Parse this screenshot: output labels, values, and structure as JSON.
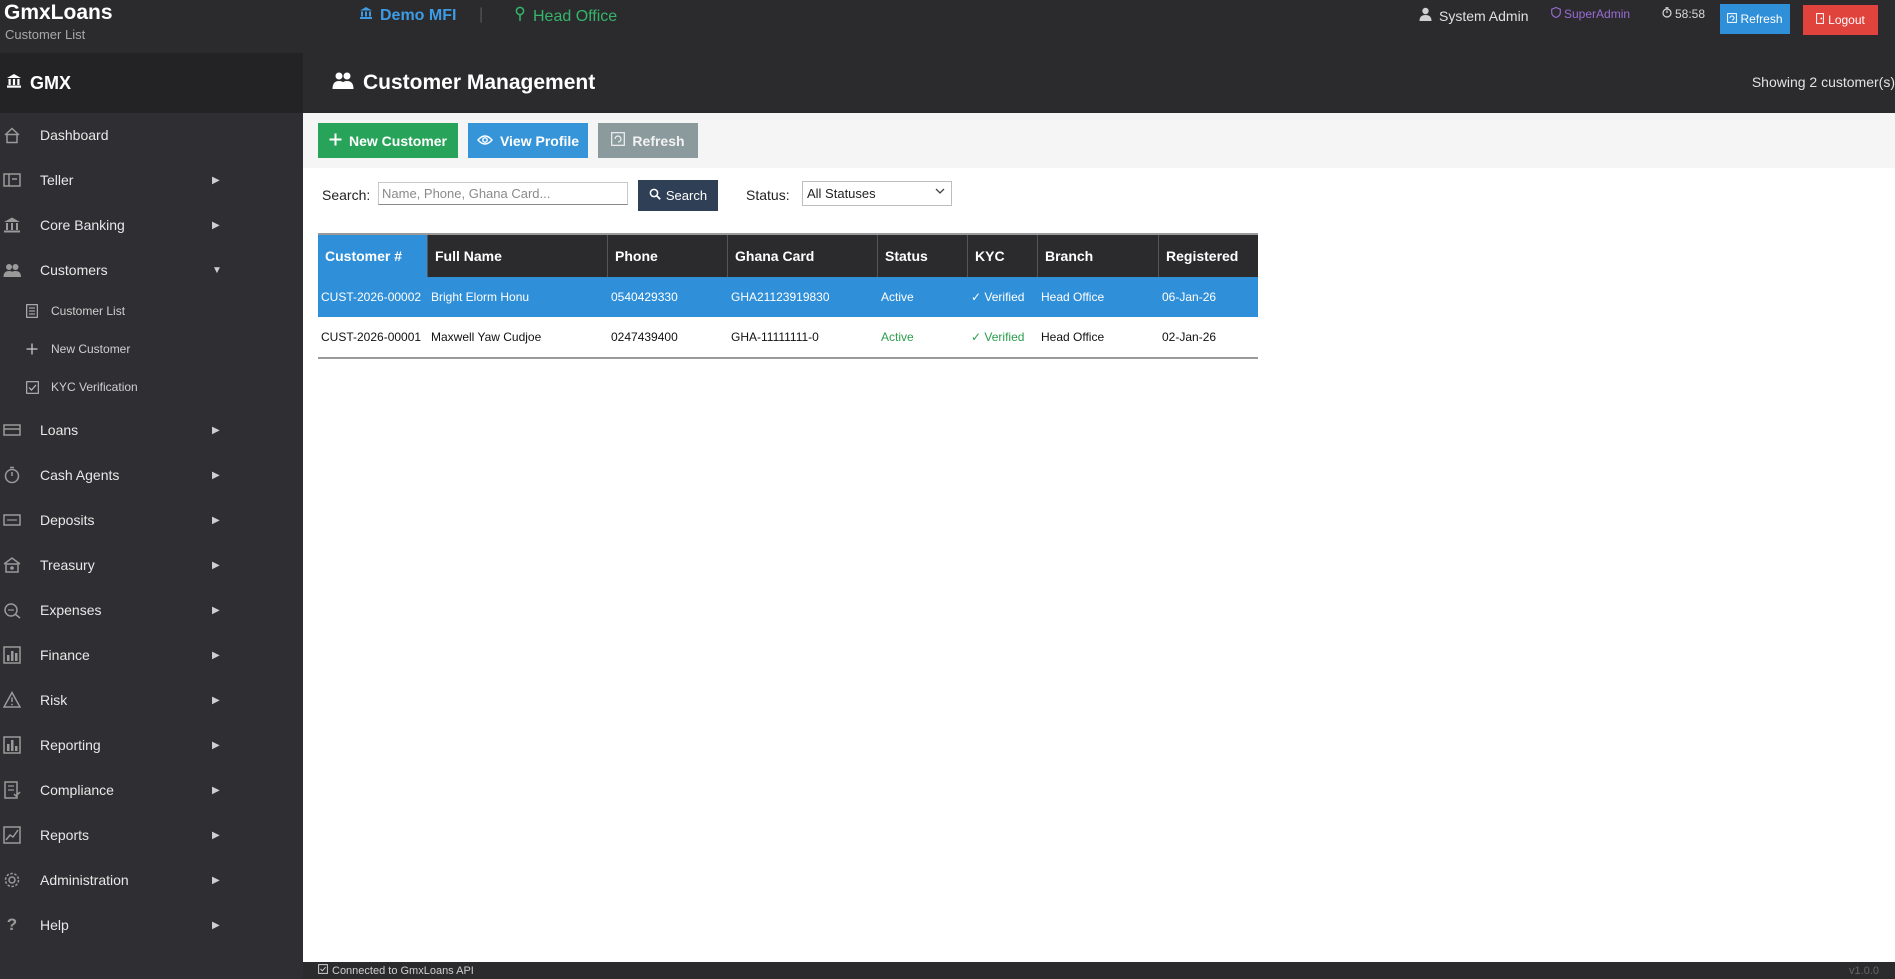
{
  "app": {
    "title": "GmxLoans",
    "subtitle": "Customer List"
  },
  "topbar": {
    "org": "Demo MFI",
    "separator": "|",
    "branch": "Head Office",
    "user": "System Admin",
    "role": "SuperAdmin",
    "timer": "58:58",
    "refresh_label": "Refresh",
    "logout_label": "Logout"
  },
  "sidebar": {
    "brand": "GMX",
    "items": [
      {
        "label": "Dashboard",
        "icon": "home-icon"
      },
      {
        "label": "Teller",
        "icon": "teller-icon"
      },
      {
        "label": "Core Banking",
        "icon": "bank-icon"
      },
      {
        "label": "Customers",
        "icon": "users-icon"
      },
      {
        "label": "Loans",
        "icon": "card-icon"
      },
      {
        "label": "Cash Agents",
        "icon": "timer-icon"
      },
      {
        "label": "Deposits",
        "icon": "atm-icon"
      },
      {
        "label": "Treasury",
        "icon": "treasury-icon"
      },
      {
        "label": "Expenses",
        "icon": "expenses-icon"
      },
      {
        "label": "Finance",
        "icon": "chart-icon"
      },
      {
        "label": "Risk",
        "icon": "warning-icon"
      },
      {
        "label": "Reporting",
        "icon": "bar-chart-icon"
      },
      {
        "label": "Compliance",
        "icon": "compliance-icon"
      },
      {
        "label": "Reports",
        "icon": "line-chart-icon"
      },
      {
        "label": "Administration",
        "icon": "gear-icon"
      },
      {
        "label": "Help",
        "icon": "help-icon"
      }
    ],
    "sub_items": [
      {
        "label": "Customer List",
        "icon": "list-icon"
      },
      {
        "label": "New Customer",
        "icon": "plus-icon"
      },
      {
        "label": "KYC Verification",
        "icon": "check-icon"
      }
    ]
  },
  "header": {
    "title": "Customer Management",
    "showing": "Showing 2 customer(s)"
  },
  "toolbar": {
    "new_label": "New Customer",
    "view_label": "View Profile",
    "refresh_label": "Refresh"
  },
  "search": {
    "label": "Search:",
    "placeholder": "Name, Phone, Ghana Card...",
    "button": "Search",
    "status_label": "Status:",
    "status_value": "All Statuses"
  },
  "table": {
    "columns": [
      "Customer #",
      "Full Name",
      "Phone",
      "Ghana Card",
      "Status",
      "KYC",
      "Branch",
      "Registered"
    ],
    "rows": [
      [
        "CUST-2026-00002",
        "Bright Elorm Honu",
        "0540429330",
        "GHA21123919830",
        "Active",
        "✓ Verified",
        "Head Office",
        "06-Jan-26"
      ],
      [
        "CUST-2026-00001",
        "Maxwell Yaw Cudjoe",
        "0247439400",
        "GHA-11111111-0",
        "Active",
        "✓ Verified",
        "Head Office",
        "02-Jan-26"
      ]
    ]
  },
  "statusbar": {
    "text": "Connected to GmxLoans API",
    "version": "v1.0.0"
  },
  "colors": {
    "accent": "#2f8fd8",
    "success": "#27a45a",
    "danger": "#e0433b",
    "dark": "#2b2b2e"
  }
}
